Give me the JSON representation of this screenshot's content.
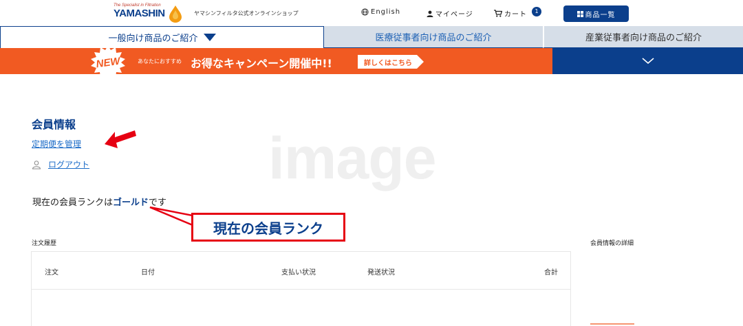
{
  "header": {
    "logo_tagline": "The Specialist in Filtration",
    "logo_text": "YAMASHIN",
    "shop_name": "ヤマシンフィルタ公式オンラインショップ",
    "english_label": "English",
    "mypage_label": "マイページ",
    "cart_label": "カート",
    "cart_count": "1",
    "products_button_label": "商品一覧"
  },
  "tabs": [
    {
      "label": "一般向け商品のご紹介",
      "active": true
    },
    {
      "label": "医療従事者向け商品のご紹介",
      "active": false
    },
    {
      "label": "産業従事者向け商品のご紹介",
      "active": false
    }
  ],
  "banner": {
    "new_badge": "NEW",
    "small_text": "あなたにおすすめ",
    "main_text": "お得なキャンペーン開催中!!",
    "detail_label": "詳しくはこちら"
  },
  "main": {
    "watermark": "image",
    "member_title": "会員情報",
    "subscription_link": "定期便を管理",
    "logout_label": "ログアウト",
    "rank_prefix": "現在の会員ランクは",
    "rank_value": "ゴールド",
    "rank_suffix": "です",
    "callout_label": "現在の会員ランク",
    "order_history_label": "注文履歴",
    "member_detail_label": "会員情報の詳細",
    "table_headers": [
      "注文",
      "日付",
      "支払い状況",
      "発送状況",
      "合計"
    ]
  },
  "colors": {
    "brand_navy": "#0b3f8c",
    "banner_orange": "#f15a22",
    "link_blue": "#1c6cc8",
    "annotation_red": "#e60012",
    "tab_inactive_bg": "#d6dee8"
  }
}
